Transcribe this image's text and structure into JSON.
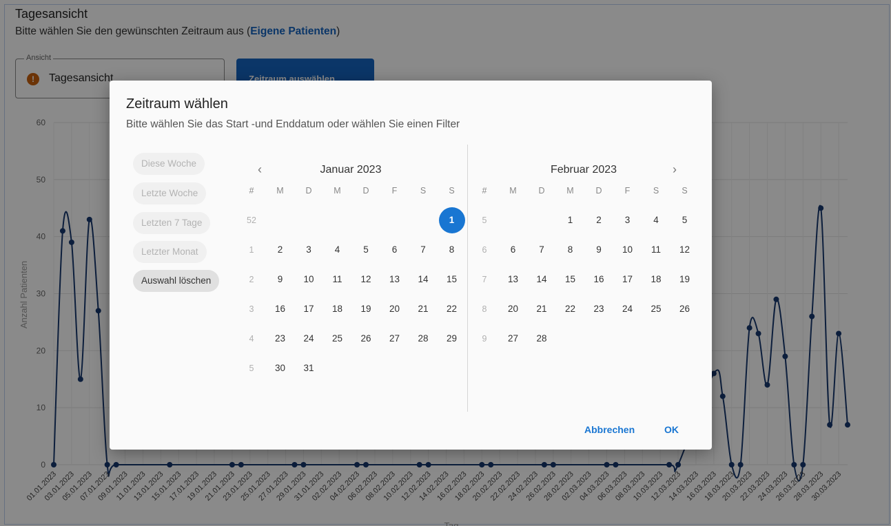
{
  "page": {
    "title": "Tagesansicht",
    "subtitle_prefix": "Bitte wählen Sie den gewünschten Zeitraum aus (",
    "subtitle_link": "Eigene Patienten",
    "subtitle_suffix": ")",
    "view_field": {
      "legend": "Ansicht",
      "value": "Tagesansicht",
      "icon": "info-icon"
    },
    "range_button": {
      "label": "Zeitraum auswählen",
      "icon": "calendar-icon"
    }
  },
  "dialog": {
    "title": "Zeitraum wählen",
    "subtitle": "Bitte wählen Sie das Start -und Enddatum oder wählen Sie einen Filter",
    "filters": [
      "Diese Woche",
      "Letzte Woche",
      "Letzten 7 Tage",
      "Letzter Monat",
      "Auswahl löschen"
    ],
    "weekday_headers": [
      "#",
      "M",
      "D",
      "M",
      "D",
      "F",
      "S",
      "S"
    ],
    "selected_date": "2023-01-01",
    "months": [
      {
        "label": "Januar 2023",
        "weeks": [
          {
            "wk": "52",
            "days": [
              "",
              "",
              "",
              "",
              "",
              "",
              "1"
            ]
          },
          {
            "wk": "1",
            "days": [
              "2",
              "3",
              "4",
              "5",
              "6",
              "7",
              "8"
            ]
          },
          {
            "wk": "2",
            "days": [
              "9",
              "10",
              "11",
              "12",
              "13",
              "14",
              "15"
            ]
          },
          {
            "wk": "3",
            "days": [
              "16",
              "17",
              "18",
              "19",
              "20",
              "21",
              "22"
            ]
          },
          {
            "wk": "4",
            "days": [
              "23",
              "24",
              "25",
              "26",
              "27",
              "28",
              "29"
            ]
          },
          {
            "wk": "5",
            "days": [
              "30",
              "31",
              "",
              "",
              "",
              "",
              ""
            ]
          }
        ]
      },
      {
        "label": "Februar 2023",
        "weeks": [
          {
            "wk": "5",
            "days": [
              "",
              "",
              "1",
              "2",
              "3",
              "4",
              "5"
            ]
          },
          {
            "wk": "6",
            "days": [
              "6",
              "7",
              "8",
              "9",
              "10",
              "11",
              "12"
            ]
          },
          {
            "wk": "7",
            "days": [
              "13",
              "14",
              "15",
              "16",
              "17",
              "18",
              "19"
            ]
          },
          {
            "wk": "8",
            "days": [
              "20",
              "21",
              "22",
              "23",
              "24",
              "25",
              "26"
            ]
          },
          {
            "wk": "9",
            "days": [
              "27",
              "28",
              "",
              "",
              "",
              "",
              ""
            ]
          }
        ]
      }
    ],
    "cancel_label": "Abbrechen",
    "ok_label": "OK"
  },
  "colors": {
    "accent": "#1565c0",
    "selected_day": "#1976d2",
    "series": "#17386f",
    "info_icon": "#c8600e"
  },
  "chart_data": {
    "type": "line",
    "ylabel": "Anzahl Patienten",
    "xlabel": "Tag",
    "ylim": [
      0,
      60
    ],
    "yticks": [
      0,
      10,
      20,
      30,
      40,
      50,
      60
    ],
    "grid": true,
    "x_tick_labels": [
      "01.01.2023",
      "03.01.2023",
      "05.01.2023",
      "07.01.2023",
      "09.01.2023",
      "11.01.2023",
      "13.01.2023",
      "15.01.2023",
      "17.01.2023",
      "19.01.2023",
      "21.01.2023",
      "23.01.2023",
      "25.01.2023",
      "27.01.2023",
      "29.01.2023",
      "31.01.2023",
      "02.02.2023",
      "04.02.2023",
      "06.02.2023",
      "08.02.2023",
      "10.02.2023",
      "12.02.2023",
      "14.02.2023",
      "16.02.2023",
      "18.02.2023",
      "20.02.2023",
      "22.02.2023",
      "24.02.2023",
      "26.02.2023",
      "28.02.2023",
      "02.03.2023",
      "04.03.2023",
      "06.03.2023",
      "08.03.2023",
      "10.03.2023",
      "12.03.2023",
      "14.03.2023",
      "16.03.2023",
      "18.03.2023",
      "20.03.2023",
      "22.03.2023",
      "24.03.2023",
      "26.03.2023",
      "28.03.2023",
      "30.03.2023"
    ],
    "series": [
      {
        "points": [
          [
            "01.01.2023",
            0
          ],
          [
            "02.01.2023",
            41
          ],
          [
            "03.01.2023",
            39
          ],
          [
            "04.01.2023",
            15
          ],
          [
            "05.01.2023",
            43
          ],
          [
            "06.01.2023",
            27
          ],
          [
            "07.01.2023",
            0
          ],
          [
            "08.01.2023",
            0
          ],
          [
            "14.01.2023",
            0
          ],
          [
            "21.01.2023",
            0
          ],
          [
            "22.01.2023",
            0
          ],
          [
            "28.01.2023",
            0
          ],
          [
            "29.01.2023",
            0
          ],
          [
            "04.02.2023",
            0
          ],
          [
            "05.02.2023",
            0
          ],
          [
            "11.02.2023",
            0
          ],
          [
            "12.02.2023",
            0
          ],
          [
            "18.02.2023",
            0
          ],
          [
            "19.02.2023",
            0
          ],
          [
            "25.02.2023",
            0
          ],
          [
            "26.02.2023",
            0
          ],
          [
            "04.03.2023",
            0
          ],
          [
            "05.03.2023",
            0
          ],
          [
            "11.03.2023",
            0
          ],
          [
            "12.03.2023",
            0
          ],
          [
            "16.03.2023",
            16
          ],
          [
            "17.03.2023",
            12
          ],
          [
            "18.03.2023",
            0
          ],
          [
            "19.03.2023",
            0
          ],
          [
            "20.03.2023",
            24
          ],
          [
            "21.03.2023",
            23
          ],
          [
            "22.03.2023",
            14
          ],
          [
            "23.03.2023",
            29
          ],
          [
            "24.03.2023",
            19
          ],
          [
            "25.03.2023",
            0
          ],
          [
            "26.03.2023",
            0
          ],
          [
            "27.03.2023",
            26
          ],
          [
            "28.03.2023",
            45
          ],
          [
            "29.03.2023",
            7
          ],
          [
            "30.03.2023",
            23
          ],
          [
            "31.03.2023",
            7
          ]
        ]
      }
    ]
  }
}
